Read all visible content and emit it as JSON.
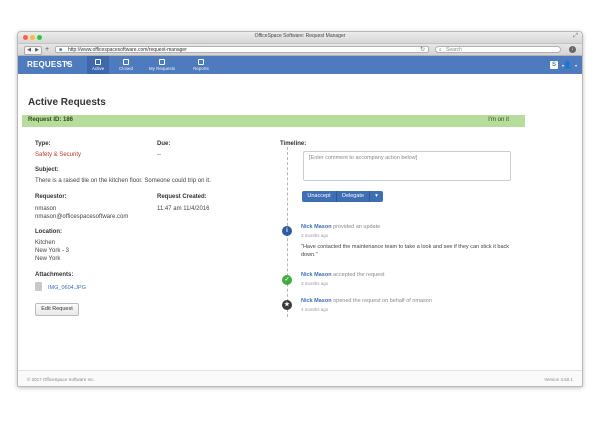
{
  "window": {
    "title": "OfficeSpace Software: Request Manager"
  },
  "browser": {
    "url": "http://www.officespacesoftware.com/request-manager",
    "search_placeholder": "Search"
  },
  "nav": {
    "brand": "REQUESTS",
    "tabs": [
      {
        "label": "Active",
        "icon": "clipboard-icon"
      },
      {
        "label": "Closed",
        "icon": "check-icon"
      },
      {
        "label": "My Requests",
        "icon": "person-icon"
      },
      {
        "label": "Reports",
        "icon": "bar-chart-icon"
      }
    ]
  },
  "page": {
    "title": "Active Requests",
    "request_id": "Request ID: 186",
    "status": "I'm on it"
  },
  "details": {
    "type_label": "Type:",
    "type_value": "Safety & Security",
    "due_label": "Due:",
    "due_value": "--",
    "subject_label": "Subject:",
    "subject_value": "There is a raised tile on the kitchen floor. Someone could trip on it.",
    "requestor_label": "Requestor:",
    "requestor_name": "nmason",
    "requestor_email": "nmason@officespacesoftware.com",
    "created_label": "Request Created:",
    "created_value": "11:47 am 11/4/2016",
    "location_label": "Location:",
    "location_lines": [
      "Kitchen",
      "New York - 3",
      "New York"
    ],
    "attachments_label": "Attachments:",
    "attachment_file": "IMG_0604.JPG",
    "edit_button": "Edit Request"
  },
  "timeline": {
    "label": "Timeline:",
    "comment_placeholder": "[Enter comment to accompany action below]",
    "buttons": [
      "Unaccept",
      "Delegate",
      "▾"
    ],
    "entries": [
      {
        "user": "Nick Mason",
        "action": "provided an update",
        "time": "3 months ago",
        "body": "\"Have contacted the maintenance team to take a look and see if they can stick it back down.\"",
        "icon": "info-icon",
        "color": "#2f5aa0"
      },
      {
        "user": "Nick Mason",
        "action": "accepted the request",
        "time": "3 months ago",
        "body": "",
        "icon": "check-circle-icon",
        "color": "#3fae3f"
      },
      {
        "user": "Nick Mason",
        "action": "opened the request on behalf of nmason",
        "time": "4 months ago",
        "body": "",
        "icon": "star-icon",
        "color": "#3a3a3a"
      }
    ]
  },
  "footer": {
    "copyright": "© 2017 OfficeSpace Software Inc.",
    "version": "Version 3.50.1"
  },
  "colors": {
    "nav": "#4e7bbd",
    "status_band": "#b7dd9d",
    "accent": "#3e6eb4"
  }
}
